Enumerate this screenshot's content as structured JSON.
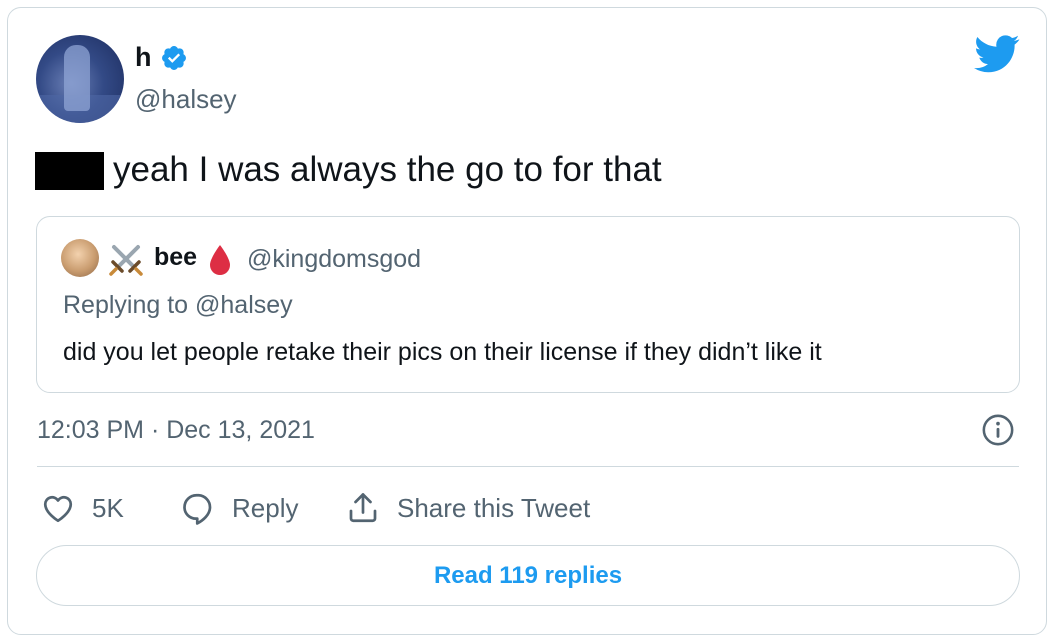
{
  "author": {
    "display_name": "h",
    "handle": "@halsey",
    "verified": true
  },
  "tweet": {
    "text": "yeah I was always the go to for that"
  },
  "quoted_tweet": {
    "display_name": "bee",
    "handle": "@kingdomsgod",
    "replying_to": "Replying to @halsey",
    "text": "did you let people retake their pics on their license if they didn’t like it"
  },
  "meta": {
    "timestamp": "12:03 PM · Dec 13, 2021"
  },
  "actions": {
    "like_count": "5K",
    "reply_label": "Reply",
    "share_label": "Share this Tweet"
  },
  "read_replies_label": "Read 119 replies",
  "colors": {
    "accent": "#1d9bf0",
    "secondary_text": "#536471",
    "border": "#cfd9de"
  },
  "icons": [
    "verified-badge-icon",
    "twitter-bird-icon",
    "crossed-swords-icon",
    "blood-drop-icon",
    "info-icon",
    "heart-icon",
    "reply-bubble-icon",
    "share-icon"
  ]
}
